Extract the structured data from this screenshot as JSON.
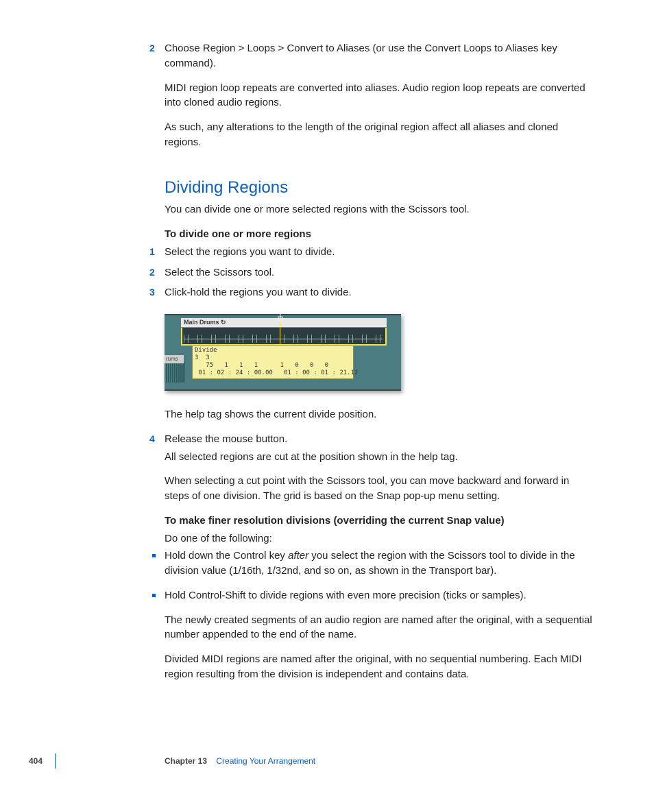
{
  "step2_prev": {
    "num": "2",
    "text": "Choose Region > Loops > Convert to Aliases (or use the Convert Loops to Aliases key command).",
    "para1": "MIDI region loop repeats are converted into aliases. Audio region loop repeats are converted into cloned audio regions.",
    "para2": "As such, any alterations to the length of the original region affect all aliases and cloned regions."
  },
  "section": {
    "heading": "Dividing Regions",
    "intro": "You can divide one or more selected regions with the Scissors tool.",
    "task1_title": "To divide one or more regions",
    "steps": [
      {
        "num": "1",
        "text": "Select the regions you want to divide."
      },
      {
        "num": "2",
        "text": "Select the Scissors tool."
      },
      {
        "num": "3",
        "text": "Click-hold the regions you want to divide."
      }
    ],
    "shot": {
      "region_label": "Main Drums",
      "rums_label": "rums",
      "tooltip_title": "Divide",
      "tooltip_row2": "3  3\n   75   1   1   1      1   0   0   0",
      "tooltip_row3": " 01 : 02 : 24 : 00.00   01 : 00 : 01 : 21.12"
    },
    "after_shot": "The help tag shows the current divide position.",
    "step4": {
      "num": "4",
      "text": "Release the mouse button."
    },
    "step4_p1": "All selected regions are cut at the position shown in the help tag.",
    "step4_p2": "When selecting a cut point with the Scissors tool, you can move backward and forward in steps of one division. The grid is based on the Snap pop-up menu setting.",
    "task2_title": "To make finer resolution divisions (overriding the current Snap value)",
    "task2_intro": "Do one of the following:",
    "bullets": [
      {
        "pre": "Hold down the Control key ",
        "it": "after",
        "post": " you select the region with the Scissors tool to divide in the division value (1/16th, 1/32nd, and so on, as shown in the Transport bar)."
      },
      {
        "pre": "Hold Control-Shift to divide regions with even more precision (ticks or samples).",
        "it": "",
        "post": ""
      }
    ],
    "tail_p1": "The newly created segments of an audio region are named after the original, with a sequential number appended to the end of the name.",
    "tail_p2": "Divided MIDI regions are named after the original, with no sequential numbering. Each MIDI region resulting from the division is independent and contains data."
  },
  "footer": {
    "page": "404",
    "chapter_label": "Chapter 13",
    "chapter_title": "Creating Your Arrangement"
  }
}
